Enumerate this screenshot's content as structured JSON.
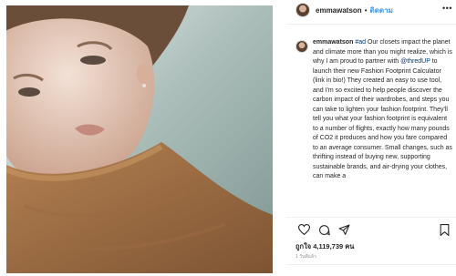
{
  "post": {
    "username": "emmawatson",
    "follow_label": "ติดตาม",
    "separator": "•",
    "more_label": "•••",
    "caption": {
      "username": "emmawatson",
      "hashtag": "#ad",
      "text_before_mention": " Our closets impact the planet and climate more than you might realize, which is why I am proud to partner with ",
      "mention": "@thredUP",
      "text_after_mention": " to launch their new Fashion Footprint Calculator (link in bio!) They created an easy to use tool, and I'm so excited to help people discover the carbon impact of their wardrobes, and steps you can take to lighten your fashion footprint. They'll tell you what your fashion footprint is equivalent to a number of flights, exactly how many pounds of CO2 it produces and how you fare compared to an average consumer. Small changes, such as thrifting instead of buying new, supporting sustainable brands, and air-drying your clothes, can make a"
    },
    "likes_text": "ถูกใจ 4,119,739 คน",
    "timestamp": "1 วันที่แล้ว"
  },
  "icons": [
    "heart-icon",
    "comment-icon",
    "share-icon",
    "bookmark-icon"
  ],
  "colors": {
    "link": "#00376b",
    "follow": "#3897f0",
    "text": "#262626",
    "muted": "#8e8e8e"
  }
}
